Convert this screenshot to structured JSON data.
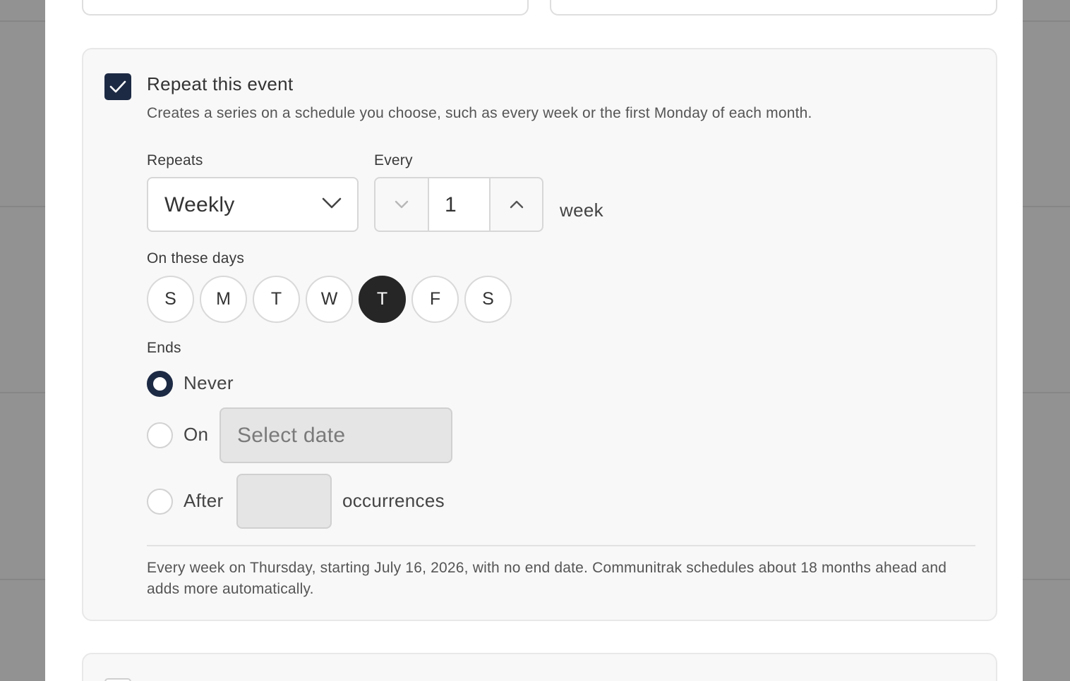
{
  "colors": {
    "accent": "#1d2a44",
    "day_active": "#262626",
    "overlay": "#929292"
  },
  "repeat": {
    "checkbox_checked": true,
    "check_icon": "check-icon",
    "title": "Repeat this event",
    "description": "Creates a series on a schedule you choose, such as every week or the first Monday of each month."
  },
  "repeats": {
    "label": "Repeats",
    "value": "Weekly",
    "icon": "chevron-down-icon"
  },
  "every": {
    "label": "Every",
    "value": "1",
    "unit": "week",
    "decrement_icon": "chevron-down-icon",
    "increment_icon": "chevron-up-icon"
  },
  "days": {
    "label": "On these days",
    "items": [
      {
        "letter": "S",
        "selected": false
      },
      {
        "letter": "M",
        "selected": false
      },
      {
        "letter": "T",
        "selected": false
      },
      {
        "letter": "W",
        "selected": false
      },
      {
        "letter": "T",
        "selected": true
      },
      {
        "letter": "F",
        "selected": false
      },
      {
        "letter": "S",
        "selected": false
      }
    ]
  },
  "ends": {
    "label": "Ends",
    "selected": "never",
    "never_label": "Never",
    "on_label": "On",
    "date_placeholder": "Select date",
    "after_label": "After",
    "after_value": "",
    "occurrences_label": "occurrences"
  },
  "summary": "Every week on Thursday, starting July 16, 2026, with no end date. Communitrak schedules about 18 months ahead and adds more automatically."
}
